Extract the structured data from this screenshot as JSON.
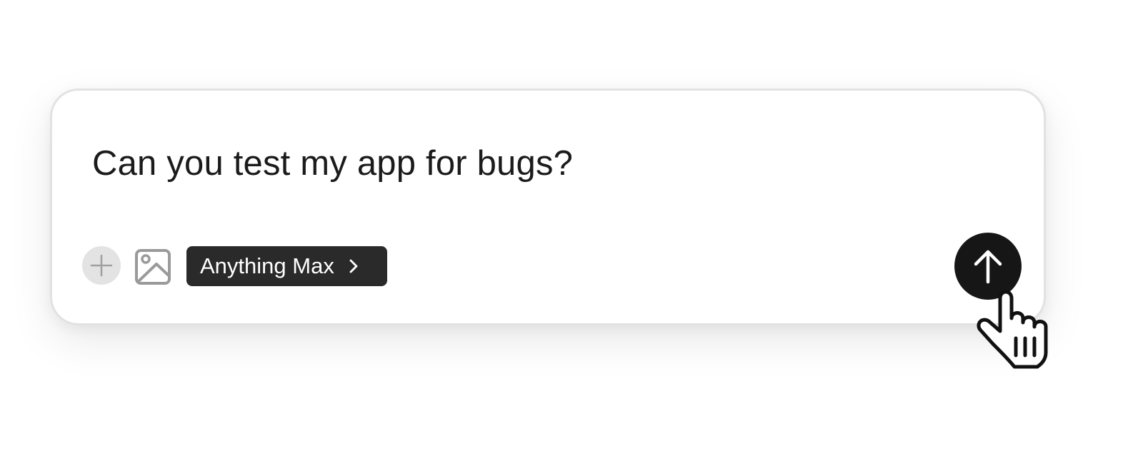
{
  "composer": {
    "prompt": "Can you test my app for bugs?",
    "model_selector": {
      "label": "Anything Max",
      "chevron_icon": "chevron-right-icon"
    },
    "icons": {
      "add": "plus-icon",
      "image": "image-icon",
      "send": "arrow-up-icon",
      "cursor": "hand-pointer-cursor-icon"
    }
  },
  "colors": {
    "background": "#ffffff",
    "composer_border": "#e2e2e2",
    "text": "#1b1b1b",
    "add_button_bg": "#e3e3e3",
    "icon_gray": "#9a9a9a",
    "model_button_bg": "#2a2a2b",
    "send_button_bg": "#161616"
  }
}
